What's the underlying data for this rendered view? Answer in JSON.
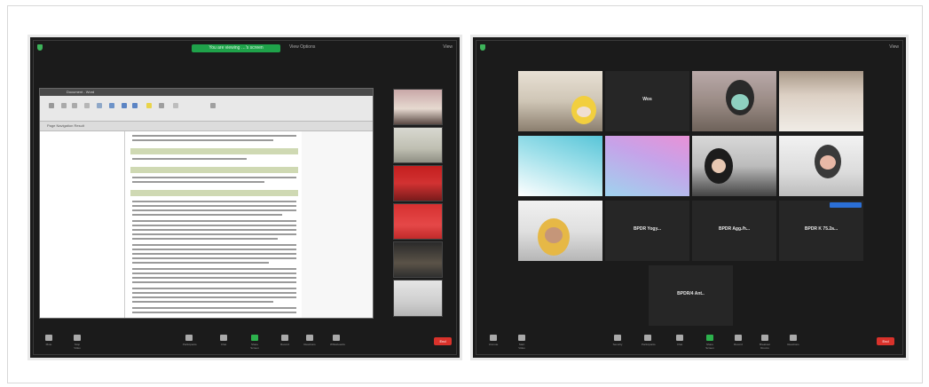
{
  "left_window": {
    "share_status": "You are viewing …'s screen",
    "view_option": "View Options",
    "view_button": "View",
    "doc_title": "Document - Word",
    "doc_tabs": "Page Navigation   Result",
    "toolbar": [
      {
        "icon": "microphone-icon",
        "label": "Mute"
      },
      {
        "icon": "camera-icon",
        "label": "Stop Video"
      },
      {
        "icon": "participants-icon",
        "label": "Participants"
      },
      {
        "icon": "chat-icon",
        "label": "Chat"
      },
      {
        "icon": "share-screen-icon",
        "label": "Share Screen"
      },
      {
        "icon": "record-icon",
        "label": "Record"
      },
      {
        "icon": "reactions-icon",
        "label": "Reactions"
      },
      {
        "icon": "whiteboard-icon",
        "label": "Whiteboards"
      }
    ],
    "end_label": "End"
  },
  "right_window": {
    "view_button": "View",
    "tiles": [
      {
        "name": "",
        "caption": "",
        "kind": "video"
      },
      {
        "name": "Wos",
        "caption": "",
        "kind": "name"
      },
      {
        "name": "",
        "caption": "",
        "kind": "video"
      },
      {
        "name": "",
        "caption": "",
        "kind": "video"
      },
      {
        "name": "",
        "caption": "",
        "kind": "video"
      },
      {
        "name": "",
        "caption": "",
        "kind": "video"
      },
      {
        "name": "",
        "caption": "",
        "kind": "video"
      },
      {
        "name": "",
        "caption": "",
        "kind": "video"
      },
      {
        "name": "",
        "caption": "",
        "kind": "video"
      },
      {
        "name": "BPDR Yogy...",
        "caption": "",
        "kind": "name"
      },
      {
        "name": "BPDR Agg./h...",
        "caption": "",
        "kind": "name"
      },
      {
        "name": "BPDR K 75.2a...",
        "caption": "",
        "kind": "name"
      },
      {
        "name": "BPDR/4 Ant..",
        "caption": "",
        "kind": "name"
      }
    ],
    "toolbar": [
      {
        "icon": "microphone-icon",
        "label": "Unmute"
      },
      {
        "icon": "camera-icon",
        "label": "Start Video"
      },
      {
        "icon": "security-icon",
        "label": "Security"
      },
      {
        "icon": "participants-icon",
        "label": "Participants"
      },
      {
        "icon": "chat-icon",
        "label": "Chat"
      },
      {
        "icon": "share-screen-icon",
        "label": "Share Screen"
      },
      {
        "icon": "record-icon",
        "label": "Record"
      },
      {
        "icon": "breakout-icon",
        "label": "Breakout Rooms"
      },
      {
        "icon": "reactions-icon",
        "label": "Reactions"
      }
    ],
    "end_label": "End"
  },
  "colors": {
    "zoom_bg": "#1b1b1b",
    "share_green": "#1fa24a",
    "end_red": "#d9322b",
    "doc_highlight": "#cfd9b3"
  }
}
